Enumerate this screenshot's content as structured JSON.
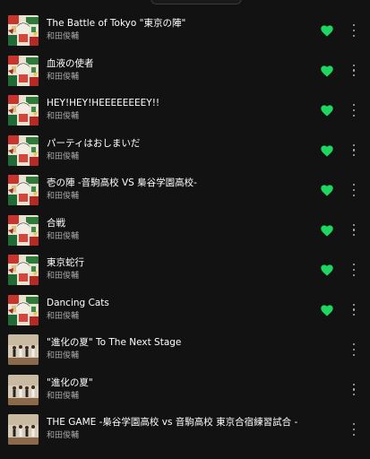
{
  "colors": {
    "accent": "#1ed760",
    "background": "#121212",
    "muted": "#a7a7a7"
  },
  "tracks": [
    {
      "title": "The Battle of Tokyo \"東京の陣\"",
      "artist": "和田俊輔",
      "liked": true,
      "cover": "anime-collage"
    },
    {
      "title": "血液の使者",
      "artist": "和田俊輔",
      "liked": true,
      "cover": "anime-collage"
    },
    {
      "title": "HEY!HEY!HEEEEEEEEY!!",
      "artist": "和田俊輔",
      "liked": true,
      "cover": "anime-collage"
    },
    {
      "title": "パーティはおしまいだ",
      "artist": "和田俊輔",
      "liked": true,
      "cover": "anime-collage"
    },
    {
      "title": "壱の陣 -音駒高校 VS 梟谷学園高校-",
      "artist": "和田俊輔",
      "liked": true,
      "cover": "anime-collage"
    },
    {
      "title": "合戦",
      "artist": "和田俊輔",
      "liked": true,
      "cover": "anime-collage"
    },
    {
      "title": "東京蛇行",
      "artist": "和田俊輔",
      "liked": true,
      "cover": "anime-collage"
    },
    {
      "title": "Dancing Cats",
      "artist": "和田俊輔",
      "liked": true,
      "cover": "anime-collage"
    },
    {
      "title": "\"進化の夏\" To The Next Stage",
      "artist": "和田俊輔",
      "liked": false,
      "cover": "stage-photo"
    },
    {
      "title": "\"進化の夏\"",
      "artist": "和田俊輔",
      "liked": false,
      "cover": "stage-photo"
    },
    {
      "title": "THE GAME -梟谷学園高校 vs 音駒高校 東京合宿練習試合 -",
      "artist": "和田俊輔",
      "liked": false,
      "cover": "stage-photo"
    }
  ]
}
